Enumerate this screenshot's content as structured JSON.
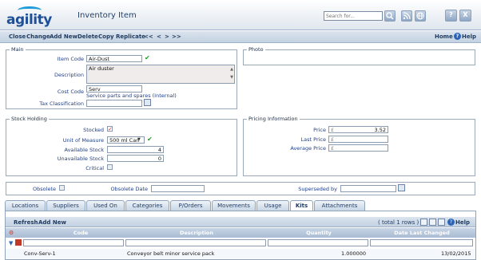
{
  "header": {
    "logo_text": "agility",
    "title": "Inventory Item",
    "search_placeholder": "Search for...",
    "help_icon_label": "?",
    "close_icon_label": "X"
  },
  "toolbar": {
    "close": "Close",
    "change": "Change",
    "add_new": "Add New",
    "delete": "Delete",
    "copy": "Copy",
    "replicate": "Replicate",
    "first": "<<",
    "prev": "<",
    ">": ">",
    "last": ">>",
    "home": "Home",
    "help": "Help"
  },
  "main": {
    "legend": "Main",
    "item_code_label": "Item Code",
    "item_code": "Air-Dust",
    "description_label": "Description",
    "description": "Air duster",
    "cost_code_label": "Cost Code",
    "cost_code": "Serv",
    "cost_code_desc": "Service parts and spares (Internal)",
    "tax_label": "Tax Classification",
    "tax_value": ""
  },
  "photo": {
    "legend": "Photo"
  },
  "stock": {
    "legend": "Stock Holding",
    "stocked_label": "Stocked",
    "stocked": true,
    "uom_label": "Unit of Measure",
    "uom_value": "500 ml Can",
    "available_label": "Available Stock",
    "available": "4",
    "unavailable_label": "Unavailable Stock",
    "unavailable": "0",
    "critical_label": "Critical",
    "critical": false
  },
  "pricing": {
    "legend": "Pricing Information",
    "currency": "£",
    "price_label": "Price",
    "price": "3.52",
    "last_price_label": "Last Price",
    "last_price": "",
    "avg_price_label": "Average Price",
    "avg_price": ""
  },
  "obsolete": {
    "obsolete_label": "Obsolete",
    "date_label": "Obsolete Date",
    "date_value": "",
    "superseded_label": "Superseded by",
    "superseded_value": ""
  },
  "tabs": [
    "Locations",
    "Suppliers",
    "Used On",
    "Categories",
    "P/Orders",
    "Movements",
    "Usage",
    "Kits",
    "Attachments"
  ],
  "active_tab": "Kits",
  "grid": {
    "refresh": "Refresh",
    "add_new": "Add New",
    "rows_info": "( total 1 rows )",
    "help": "Help",
    "columns": [
      "Code",
      "Description",
      "Quantity",
      "Date Last Changed"
    ],
    "rows": [
      {
        "code": "Conv-Serv-1",
        "description": "Conveyor belt minor service pack",
        "quantity": "1.000000",
        "date": "13/02/2015"
      }
    ]
  },
  "colors": {
    "accent": "#1d4f9a",
    "label": "#1f3f8a",
    "ok": "#1ea11e"
  }
}
